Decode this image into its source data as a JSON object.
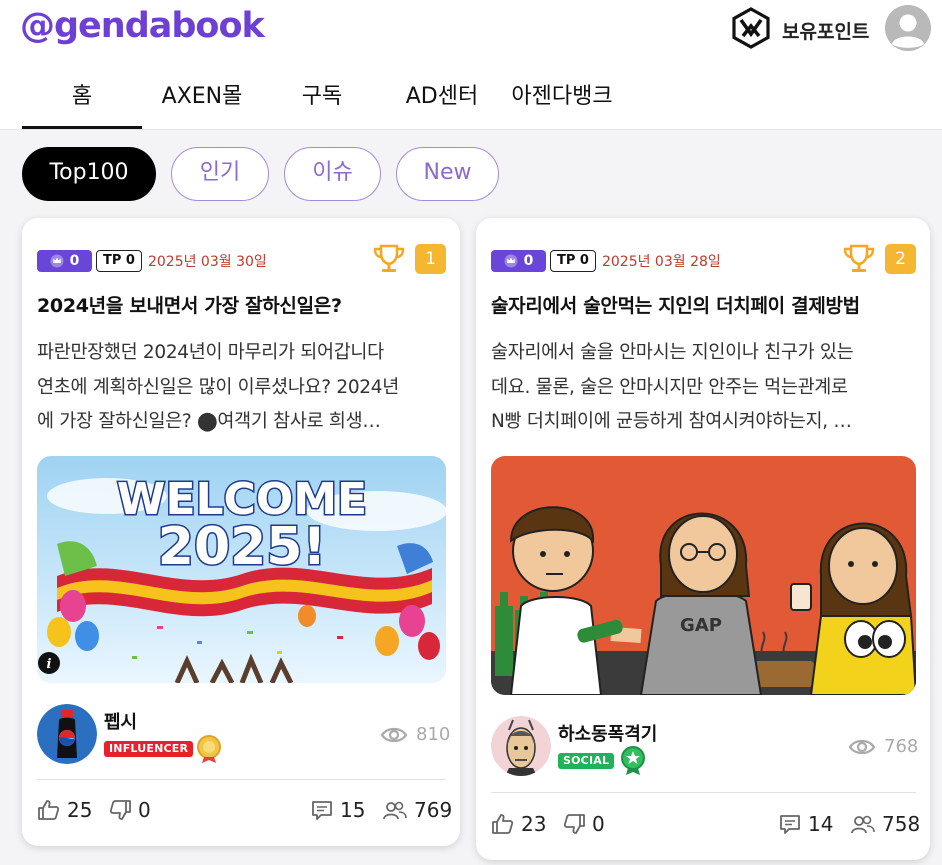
{
  "header": {
    "logo": "@gendabook",
    "points_label": "보유포인트",
    "tabs": [
      {
        "label": "홈",
        "active": true
      },
      {
        "label": "AXEN몰"
      },
      {
        "label": "구독"
      },
      {
        "label": "AD센터"
      },
      {
        "label": "아젠다뱅크"
      }
    ]
  },
  "filters": [
    {
      "label": "Top100",
      "active": true
    },
    {
      "label": "인기"
    },
    {
      "label": "이슈"
    },
    {
      "label": "New"
    }
  ],
  "colors": {
    "brand": "#6e3fd6",
    "rank_badge": "#f5b731",
    "date": "#c0392b",
    "influencer": "#e8202a",
    "social": "#1fb25a"
  },
  "cards": [
    {
      "badge_count": "0",
      "tp": "TP 0",
      "date": "2025년 03월 30일",
      "rank": "1",
      "title": "2024년을 보내면서 가장 잘하신일은?",
      "excerpt": [
        "파란만장했던 2024년이 마무리가 되어갑니다",
        "연초에 계획하신일은 많이 이루셨나요? 2024년",
        "에 가장 잘하신일은? ⬤여객기 참사로 희생…"
      ],
      "image_text": [
        "WELCOME",
        "2025!"
      ],
      "author": "펩시",
      "author_tag": "INFLUENCER",
      "views": "810",
      "likes": "25",
      "dislikes": "0",
      "comments": "15",
      "participants": "769"
    },
    {
      "badge_count": "0",
      "tp": "TP 0",
      "date": "2025년 03월 28일",
      "rank": "2",
      "title": "술자리에서 술안먹는 지인의 더치페이 결제방법",
      "excerpt": [
        "술자리에서 술을 안마시는 지인이나 친구가 있는",
        "데요. 물론, 술은 안마시지만 안주는 먹는관계로",
        "N빵 더치페이에 균등하게 참여시켜야하는지, …"
      ],
      "image_text": [
        "GAP"
      ],
      "author": "하소동폭격기",
      "author_tag": "SOCIAL",
      "views": "768",
      "likes": "23",
      "dislikes": "0",
      "comments": "14",
      "participants": "758"
    }
  ]
}
